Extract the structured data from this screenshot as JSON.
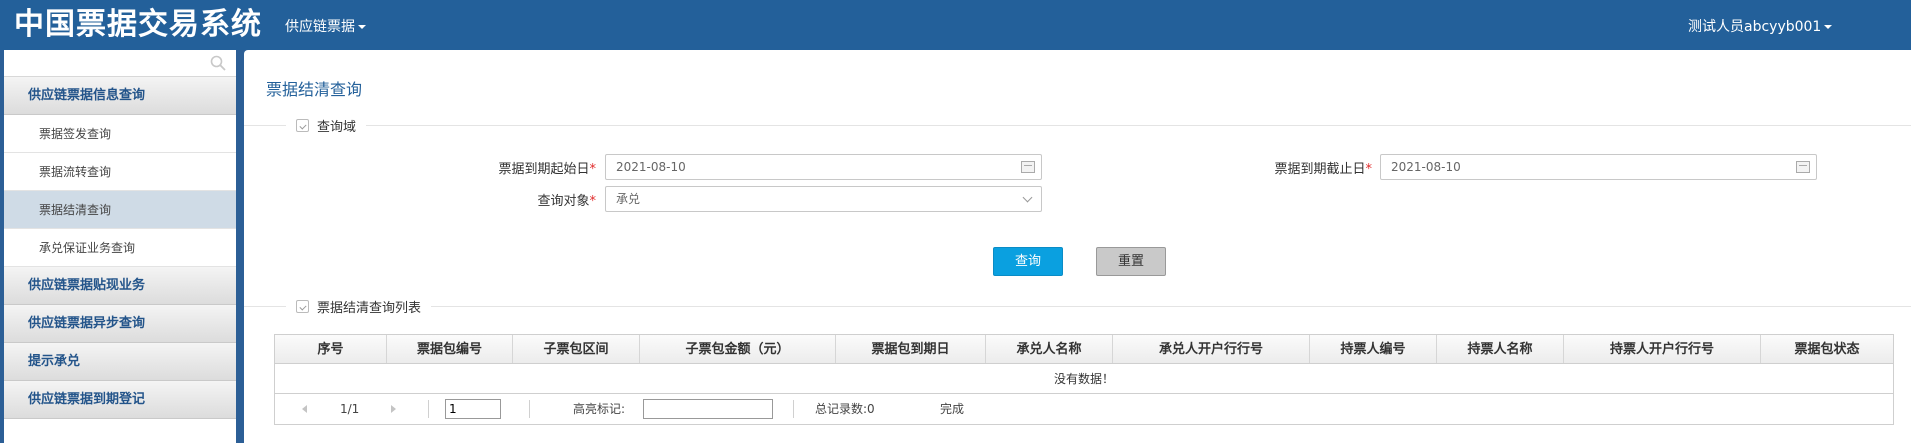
{
  "header": {
    "app_title": "中国票据交易系统",
    "menu_label": "供应链票据",
    "user_label": "测试人员abcyyb001"
  },
  "sidebar": {
    "search_placeholder": "",
    "groups": [
      {
        "label": "供应链票据信息查询"
      },
      {
        "label": "供应链票据贴现业务"
      },
      {
        "label": "供应链票据异步查询"
      },
      {
        "label": "提示承兑"
      },
      {
        "label": "供应链票据到期登记"
      }
    ],
    "sub_items": [
      {
        "label": "票据签发查询"
      },
      {
        "label": "票据流转查询"
      },
      {
        "label": "票据结清查询"
      },
      {
        "label": "承兑保证业务查询"
      }
    ],
    "active_item": "票据结清查询"
  },
  "main": {
    "page_title": "票据结清查询",
    "query_section": {
      "legend": "查询域"
    },
    "form": {
      "start_date_label": "票据到期起始日",
      "start_date_value": "2021-08-10",
      "end_date_label": "票据到期截止日",
      "end_date_value": "2021-08-10",
      "target_label": "查询对象",
      "target_value": "承兑",
      "required_mark": "*"
    },
    "buttons": {
      "query": "查询",
      "reset": "重置"
    },
    "list_section": {
      "legend": "票据结清查询列表"
    },
    "table": {
      "columns": [
        "序号",
        "票据包编号",
        "子票包区间",
        "子票包金额（元）",
        "票据包到期日",
        "承兑人名称",
        "承兑人开户行行号",
        "持票人编号",
        "持票人名称",
        "持票人开户行行号",
        "票据包状态"
      ],
      "empty_text": "没有数据！"
    },
    "pager": {
      "page_info": "1/1",
      "page_input": "1",
      "highlight_label": "高亮标记:",
      "highlight_value": "",
      "total_label": "总记录数:0",
      "status": "完成"
    }
  }
}
